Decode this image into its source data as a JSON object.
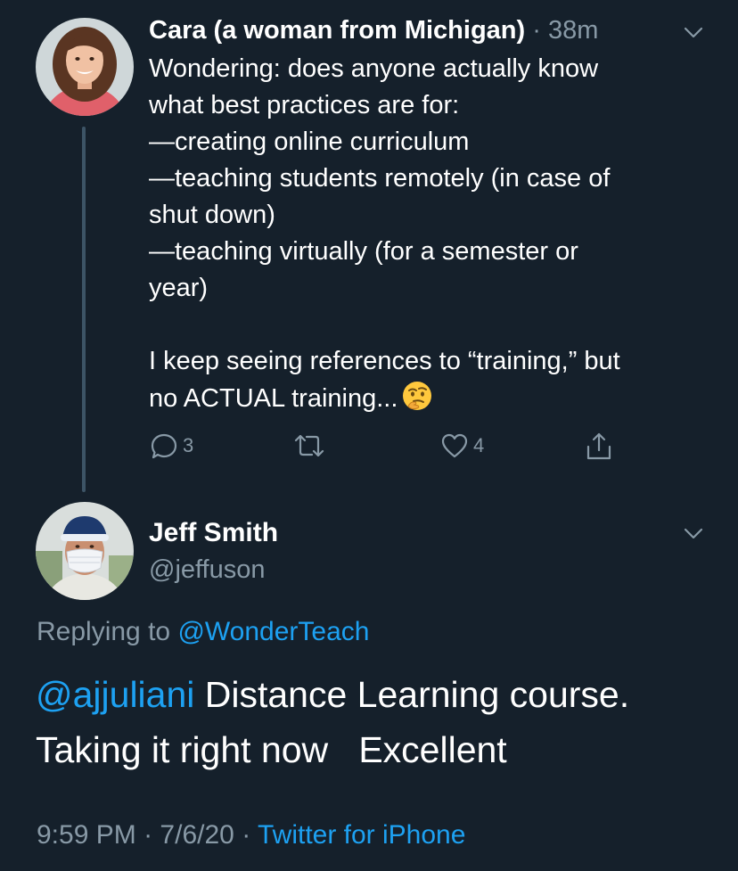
{
  "parent_tweet": {
    "author_name": "Cara (a woman from Michigan)",
    "separator": "·",
    "time_ago": "38m",
    "lines": [
      "Wondering: does anyone actually know",
      "what best practices are for:",
      "—creating online curriculum",
      "—teaching students remotely (in case of",
      "shut down)",
      "—teaching virtually (for a semester or",
      "year)"
    ],
    "closing_lines": [
      "I keep seeing references to “training,” but",
      "no ACTUAL training..."
    ],
    "emoji": "thinking-face-emoji",
    "reply_count": "3",
    "like_count": "4"
  },
  "reply_tweet": {
    "author_name": "Jeff Smith",
    "handle": "@jeffuson",
    "replying_prefix": "Replying to",
    "replying_to": "@WonderTeach",
    "mention": "@ajjuliani",
    "text_line1": " Distance Learning course.",
    "text_line2": "Taking it right now   Excellent",
    "time": "9:59 PM",
    "separator": "·",
    "date": "7/6/20",
    "source": "Twitter for iPhone"
  },
  "colors": {
    "background": "#15202b",
    "secondary_text": "#8899a6",
    "link": "#1da1f2",
    "thread_line": "#3d5466"
  }
}
